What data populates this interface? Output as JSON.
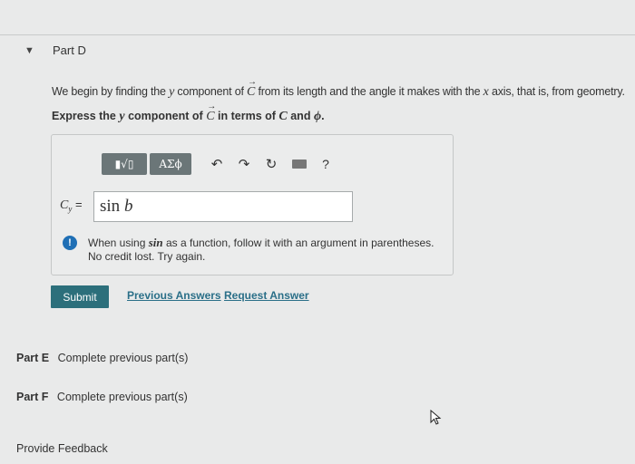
{
  "part_d": {
    "arrow": "▼",
    "title": "Part D",
    "intro_a": "We begin by finding the",
    "intro_y": "y",
    "intro_b": "component of",
    "intro_c": "C",
    "intro_d": "from its length and the angle it makes with the",
    "intro_x": "x",
    "intro_e": "axis, that is, from geometry.",
    "instr_a": "Express the",
    "instr_y": "y",
    "instr_b": "component of",
    "instr_c": "C",
    "instr_d": "in terms of",
    "instr_c2": "C",
    "instr_e": "and",
    "instr_phi": "ϕ",
    "instr_end": "."
  },
  "toolbar": {
    "templates_label": "▮√▯",
    "greek_label": "ΑΣϕ",
    "undo_glyph": "↶",
    "redo_glyph": "↷",
    "reset_glyph": "↻",
    "help_label": "?"
  },
  "answer": {
    "label_var": "C",
    "label_sub": "y",
    "label_eq": " =",
    "func": "sin",
    "arg": "b"
  },
  "feedback": {
    "icon": "!",
    "line1_a": "When using",
    "line1_code": "sin",
    "line1_b": "as a function, follow it with an argument in parentheses.",
    "line2": "No credit lost. Try again."
  },
  "actions": {
    "submit": "Submit",
    "previous_answers": "Previous Answers",
    "request_answer": "Request Answer"
  },
  "parts": {
    "e_label": "Part E",
    "e_status": "Complete previous part(s)",
    "f_label": "Part F",
    "f_status": "Complete previous part(s)"
  },
  "footer": {
    "provide_feedback": "Provide Feedback"
  },
  "colors": {
    "submit_bg": "#2c6f7b",
    "link": "#2a6f88",
    "warn": "#1f6fb5",
    "toolbar_btn": "#6b7678"
  }
}
